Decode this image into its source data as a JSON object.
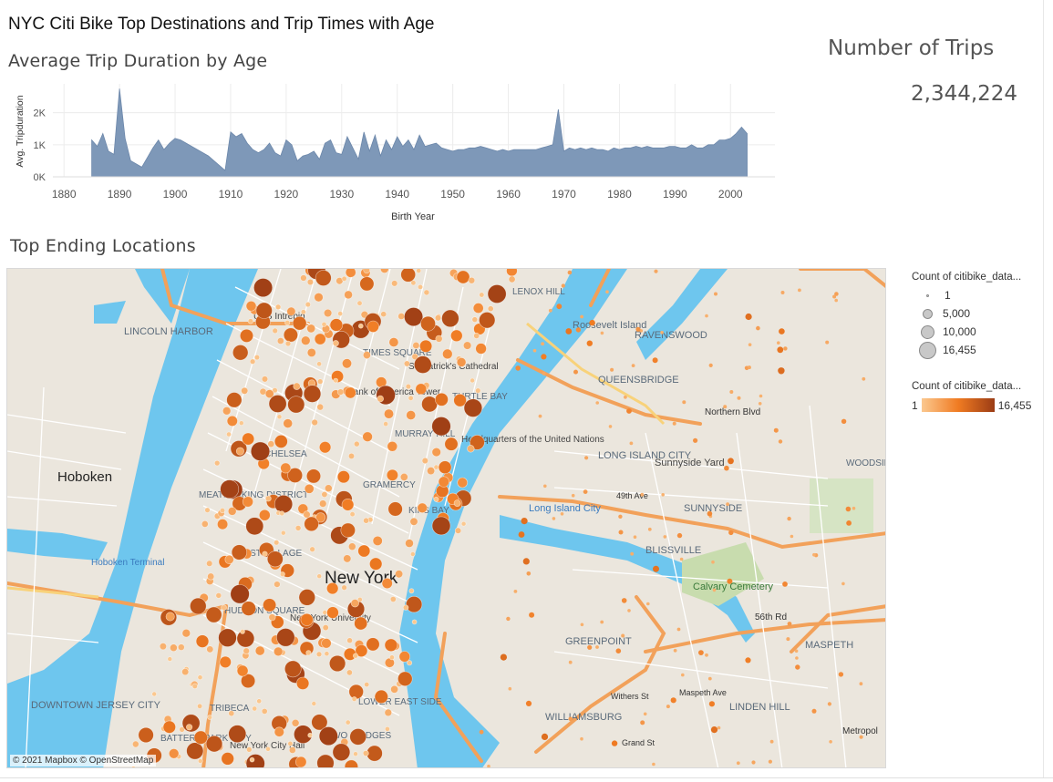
{
  "dashboard": {
    "title": "NYC Citi Bike Top Destinations and Trip Times with Age"
  },
  "chart_section": {
    "title": "Average Trip Duration by Age"
  },
  "kpi": {
    "title": "Number of Trips",
    "value": "2,344,224"
  },
  "map_section": {
    "title": "Top Ending Locations",
    "attribution": "© 2021 Mapbox © OpenStreetMap",
    "labels": [
      "Hoboken",
      "New York",
      "LINCOLN HARBOR",
      "Roosevelt Island",
      "RAVENSWOOD",
      "QUEENSBRIDGE",
      "LONG ISLAND CITY",
      "Sunnyside Yard",
      "SUNNYSIDE",
      "Long Island City",
      "BLISSVILLE",
      "Calvary Cemetery",
      "MASPETH",
      "LINDEN HILL",
      "DOWNTOWN JERSEY CITY",
      "WILLIAMSBURG",
      "GREENPOINT",
      "Hoboken Terminal",
      "MEATPACKING DISTRICT",
      "TIMES SQUARE",
      "MURRAY HILL",
      "TURTLE BAY",
      "LENOX HILL",
      "CHELSEA",
      "WEST VILLAGE",
      "HUDSON SQUARE",
      "TRIBECA",
      "BATTERY PARK CITY",
      "KIPS BAY",
      "GRAMERCY",
      "TWO BRIDGES",
      "LOWER EAST SIDE",
      "Headquarters of the United Nations",
      "Northern Blvd",
      "WOODSIDE",
      "Metropol",
      "New York University",
      "New York City Hall",
      "St. Patrick's Cathedral",
      "Bank of America Tower",
      "USS Intrepid",
      "Maspeth Ave",
      "Grand St",
      "Withers St",
      "56th Rd",
      "49th Ave"
    ]
  },
  "legend": {
    "size_title": "Count of citibike_data...",
    "size_items": [
      "1",
      "5,000",
      "10,000",
      "16,455"
    ],
    "color_title": "Count of citibike_data...",
    "color_min": "1",
    "color_max": "16,455",
    "colors": {
      "low": "#fbc88f",
      "mid": "#f07b22",
      "high": "#9b3c15"
    }
  },
  "chart_data": {
    "type": "area",
    "title": "",
    "xlabel": "Birth Year",
    "ylabel": "Avg. Tripduration",
    "xlim": [
      1878,
      2008
    ],
    "ylim": [
      0,
      2900
    ],
    "x_ticks": [
      1880,
      1890,
      1900,
      1910,
      1920,
      1930,
      1940,
      1950,
      1960,
      1970,
      1980,
      1990,
      2000
    ],
    "y_ticks": [
      0,
      1000,
      2000
    ],
    "y_tick_labels": [
      "0K",
      "1K",
      "2K"
    ],
    "color": "#7e98b8",
    "grid": true,
    "x": [
      1885,
      1886,
      1887,
      1888,
      1889,
      1890,
      1891,
      1892,
      1893,
      1894,
      1895,
      1896,
      1897,
      1898,
      1899,
      1900,
      1901,
      1902,
      1903,
      1904,
      1905,
      1906,
      1907,
      1908,
      1909,
      1910,
      1911,
      1912,
      1913,
      1914,
      1915,
      1916,
      1917,
      1918,
      1919,
      1920,
      1921,
      1922,
      1923,
      1924,
      1925,
      1926,
      1927,
      1928,
      1929,
      1930,
      1931,
      1932,
      1933,
      1934,
      1935,
      1936,
      1937,
      1938,
      1939,
      1940,
      1941,
      1942,
      1943,
      1944,
      1945,
      1946,
      1947,
      1948,
      1949,
      1950,
      1951,
      1952,
      1953,
      1954,
      1955,
      1956,
      1957,
      1958,
      1959,
      1960,
      1961,
      1962,
      1963,
      1964,
      1965,
      1966,
      1967,
      1968,
      1969,
      1970,
      1971,
      1972,
      1973,
      1974,
      1975,
      1976,
      1977,
      1978,
      1979,
      1980,
      1981,
      1982,
      1983,
      1984,
      1985,
      1986,
      1987,
      1988,
      1989,
      1990,
      1991,
      1992,
      1993,
      1994,
      1995,
      1996,
      1997,
      1998,
      1999,
      2000,
      2001,
      2002,
      2003
    ],
    "y": [
      1150,
      950,
      1350,
      800,
      700,
      2750,
      1200,
      500,
      400,
      300,
      600,
      900,
      1150,
      850,
      1050,
      1200,
      1150,
      1050,
      950,
      850,
      750,
      650,
      500,
      350,
      200,
      1400,
      1250,
      1350,
      1050,
      850,
      750,
      850,
      1050,
      750,
      650,
      1150,
      1000,
      500,
      650,
      700,
      800,
      550,
      1050,
      1150,
      750,
      700,
      1250,
      900,
      550,
      1400,
      800,
      1300,
      650,
      1150,
      850,
      1250,
      950,
      1150,
      850,
      1300,
      950,
      1000,
      1050,
      900,
      850,
      800,
      850,
      850,
      900,
      900,
      950,
      900,
      850,
      800,
      850,
      800,
      850,
      850,
      850,
      850,
      850,
      900,
      950,
      1000,
      2100,
      800,
      900,
      850,
      900,
      850,
      900,
      850,
      850,
      800,
      900,
      850,
      900,
      900,
      950,
      900,
      950,
      900,
      900,
      900,
      950,
      950,
      900,
      900,
      1000,
      900,
      900,
      1000,
      1000,
      1150,
      1150,
      1200,
      1350,
      1550,
      1350,
      1500,
      1400
    ],
    "labels_note_free": true
  }
}
